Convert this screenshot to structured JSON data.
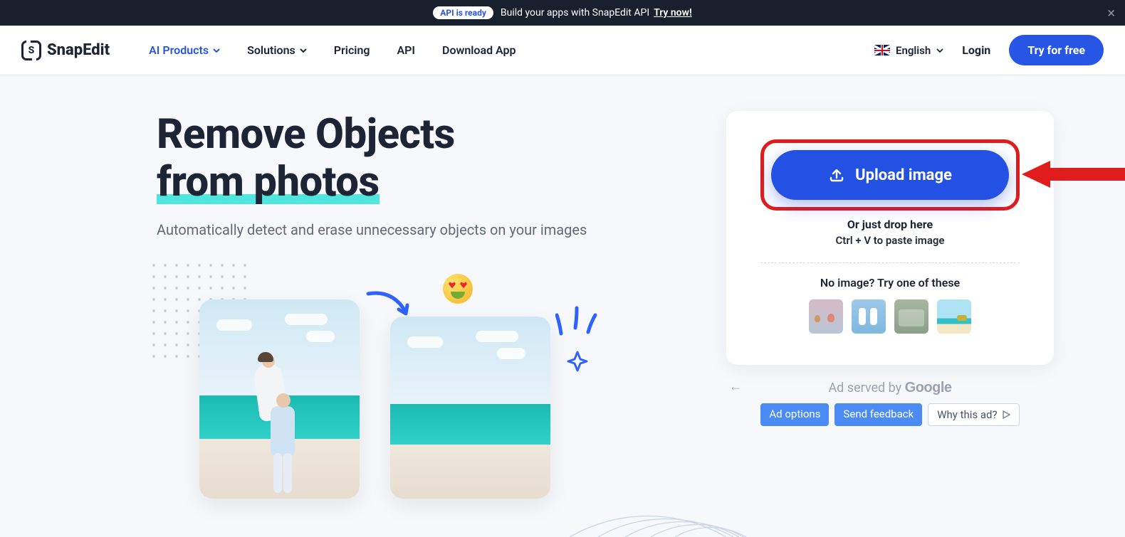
{
  "banner": {
    "pill": "API is ready",
    "text": "Build your apps with SnapEdit API",
    "cta": "Try now!"
  },
  "brand": {
    "name": "SnapEdit",
    "logo_letter": "S"
  },
  "nav": {
    "items": [
      {
        "label": "AI Products",
        "dropdown": true,
        "active": true
      },
      {
        "label": "Solutions",
        "dropdown": true,
        "active": false
      },
      {
        "label": "Pricing",
        "dropdown": false,
        "active": false
      },
      {
        "label": "API",
        "dropdown": false,
        "active": false
      },
      {
        "label": "Download App",
        "dropdown": false,
        "active": false
      }
    ],
    "language": "English",
    "login": "Login",
    "cta": "Try for free"
  },
  "hero": {
    "title_line1": "Remove Objects",
    "title_line2": "from photos",
    "subtitle": "Automatically detect and erase unnecessary objects on your images"
  },
  "upload": {
    "button": "Upload image",
    "drop": "Or just drop here",
    "paste": "Ctrl + V to paste image",
    "try_label": "No image? Try one of these"
  },
  "ad": {
    "served_by": "Ad served by",
    "google": "Google",
    "options": "Ad options",
    "feedback": "Send feedback",
    "why": "Why this ad?"
  }
}
